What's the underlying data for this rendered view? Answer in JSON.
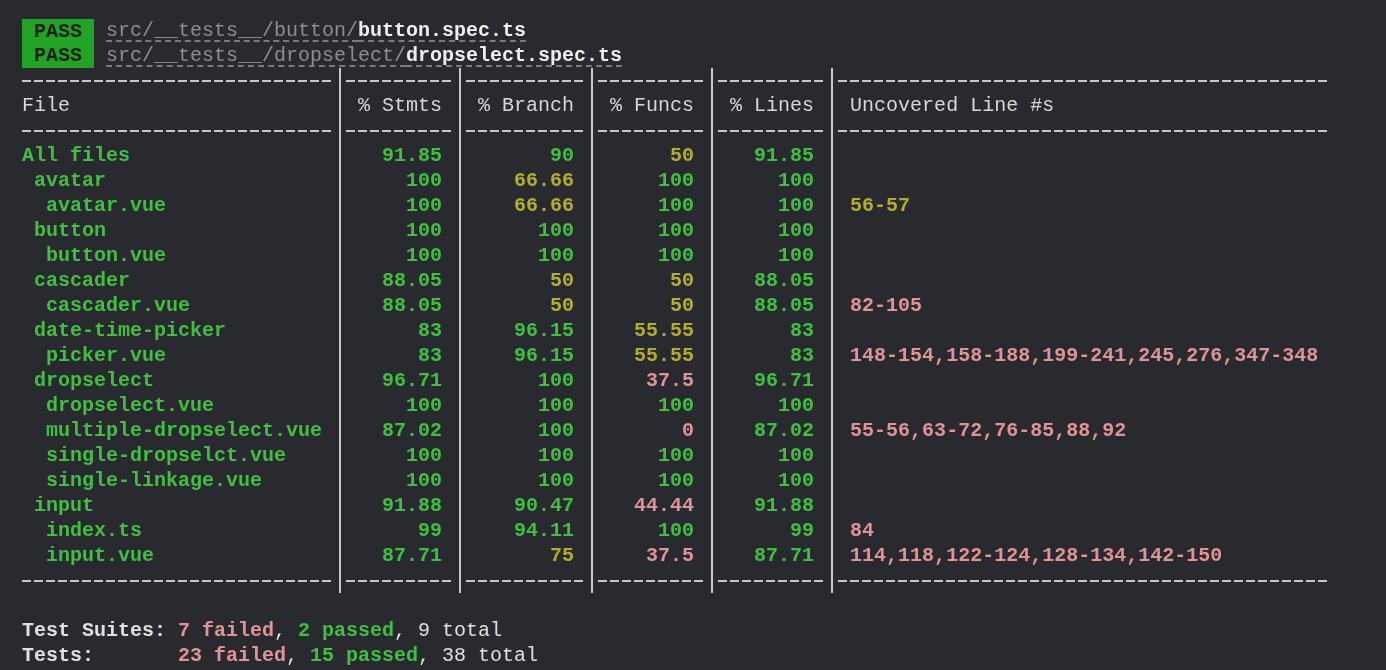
{
  "results": [
    {
      "status": "PASS",
      "path": "src/__tests__/button/**button.spec.ts**"
    },
    {
      "status": "PASS",
      "path": "src/__tests__/dropselect/**dropselect.spec.ts**"
    }
  ],
  "coverage": {
    "columns": [
      "File",
      "% Stmts",
      "% Branch",
      "% Funcs",
      "% Lines",
      "Uncovered Line #s"
    ],
    "rows": [
      {
        "cells": [
          {
            "value": "All files",
            "color": "#3ec23e"
          },
          {
            "value": "91.85",
            "color": "#3ec23e"
          },
          {
            "value": "90",
            "color": "#3ec23e"
          },
          {
            "value": "50",
            "color": "#b3ad2a"
          },
          {
            "value": "91.85",
            "color": "#3ec23e"
          }
        ],
        "children": [
          {
            "cells": [
              {
                "value": "avatar",
                "color": "#3ec23e"
              },
              {
                "value": "100",
                "color": "#3ec23e"
              },
              {
                "value": "66.66",
                "color": "#b3ad2a"
              },
              {
                "value": "100",
                "color": "#3ec23e"
              },
              {
                "value": "100",
                "color": "#3ec23e"
              }
            ],
            "children": [
              {
                "cells": [
                  {
                    "value": "avatar.vue",
                    "color": "#3ec23e"
                  },
                  {
                    "value": "100",
                    "color": "#3ec23e"
                  },
                  {
                    "value": "66.66",
                    "color": "#b3ad2a"
                  },
                  {
                    "value": "100",
                    "color": "#3ec23e"
                  },
                  {
                    "value": "100",
                    "color": "#3ec23e"
                  },
                  {
                    "value": "56-57",
                    "color": "#b3ad2a"
                  }
                ]
              }
            ]
          },
          {
            "cells": [
              {
                "value": "button",
                "color": "#3ec23e"
              },
              {
                "value": "100",
                "color": "#3ec23e"
              },
              {
                "value": "100",
                "color": "#3ec23e"
              },
              {
                "value": "100",
                "color": "#3ec23e"
              },
              {
                "value": "100",
                "color": "#3ec23e"
              }
            ],
            "children": [
              {
                "cells": [
                  {
                    "value": "button.vue",
                    "color": "#3ec23e"
                  },
                  {
                    "value": "100",
                    "color": "#3ec23e"
                  },
                  {
                    "value": "100",
                    "color": "#3ec23e"
                  },
                  {
                    "value": "100",
                    "color": "#3ec23e"
                  },
                  {
                    "value": "100",
                    "color": "#3ec23e"
                  }
                ]
              }
            ]
          },
          {
            "cells": [
              {
                "value": "cascader",
                "color": "#3ec23e"
              },
              {
                "value": "88.05",
                "color": "#3ec23e"
              },
              {
                "value": "50",
                "color": "#b3ad2a"
              },
              {
                "value": "50",
                "color": "#b3ad2a"
              },
              {
                "value": "88.05",
                "color": "#3ec23e"
              }
            ],
            "children": [
              {
                "cells": [
                  {
                    "value": "cascader.vue",
                    "color": "#3ec23e"
                  },
                  {
                    "value": "88.05",
                    "color": "#3ec23e"
                  },
                  {
                    "value": "50",
                    "color": "#b3ad2a"
                  },
                  {
                    "value": "50",
                    "color": "#b3ad2a"
                  },
                  {
                    "value": "88.05",
                    "color": "#3ec23e"
                  },
                  {
                    "value": "82-105",
                    "color": "#e29393"
                  }
                ]
              }
            ]
          },
          {
            "cells": [
              {
                "value": "date-time-picker",
                "color": "#3ec23e"
              },
              {
                "value": "83",
                "color": "#3ec23e"
              },
              {
                "value": "96.15",
                "color": "#3ec23e"
              },
              {
                "value": "55.55",
                "color": "#b3ad2a"
              },
              {
                "value": "83",
                "color": "#3ec23e"
              }
            ],
            "children": [
              {
                "cells": [
                  {
                    "value": "picker.vue",
                    "color": "#3ec23e"
                  },
                  {
                    "value": "83",
                    "color": "#3ec23e"
                  },
                  {
                    "value": "96.15",
                    "color": "#3ec23e"
                  },
                  {
                    "value": "55.55",
                    "color": "#b3ad2a"
                  },
                  {
                    "value": "83",
                    "color": "#3ec23e"
                  },
                  {
                    "value": "148-154,158-188,199-241,245,276,347-348",
                    "color": "#e29393"
                  }
                ]
              }
            ]
          },
          {
            "cells": [
              {
                "value": "dropselect",
                "color": "#3ec23e"
              },
              {
                "value": "96.71",
                "color": "#3ec23e"
              },
              {
                "value": "100",
                "color": "#3ec23e"
              },
              {
                "value": "37.5",
                "color": "#e29393"
              },
              {
                "value": "96.71",
                "color": "#3ec23e"
              }
            ],
            "children": [
              {
                "cells": [
                  {
                    "value": "dropselect.vue",
                    "color": "#3ec23e"
                  },
                  {
                    "value": "100",
                    "color": "#3ec23e"
                  },
                  {
                    "value": "100",
                    "color": "#3ec23e"
                  },
                  {
                    "value": "100",
                    "color": "#3ec23e"
                  },
                  {
                    "value": "100",
                    "color": "#3ec23e"
                  }
                ]
              },
              {
                "cells": [
                  {
                    "value": "multiple-dropselect.vue",
                    "color": "#3ec23e"
                  },
                  {
                    "value": "87.02",
                    "color": "#3ec23e"
                  },
                  {
                    "value": "100",
                    "color": "#3ec23e"
                  },
                  {
                    "value": "0",
                    "color": "#e29393"
                  },
                  {
                    "value": "87.02",
                    "color": "#3ec23e"
                  },
                  {
                    "value": "55-56,63-72,76-85,88,92",
                    "color": "#e29393"
                  }
                ]
              },
              {
                "cells": [
                  {
                    "value": "single-dropselct.vue",
                    "color": "#3ec23e"
                  },
                  {
                    "value": "100",
                    "color": "#3ec23e"
                  },
                  {
                    "value": "100",
                    "color": "#3ec23e"
                  },
                  {
                    "value": "100",
                    "color": "#3ec23e"
                  },
                  {
                    "value": "100",
                    "color": "#3ec23e"
                  }
                ]
              },
              {
                "cells": [
                  {
                    "value": "single-linkage.vue",
                    "color": "#3ec23e"
                  },
                  {
                    "value": "100",
                    "color": "#3ec23e"
                  },
                  {
                    "value": "100",
                    "color": "#3ec23e"
                  },
                  {
                    "value": "100",
                    "color": "#3ec23e"
                  },
                  {
                    "value": "100",
                    "color": "#3ec23e"
                  }
                ]
              }
            ]
          },
          {
            "cells": [
              {
                "value": "input",
                "color": "#3ec23e"
              },
              {
                "value": "91.88",
                "color": "#3ec23e"
              },
              {
                "value": "90.47",
                "color": "#3ec23e"
              },
              {
                "value": "44.44",
                "color": "#e29393"
              },
              {
                "value": "91.88",
                "color": "#3ec23e"
              }
            ],
            "children": [
              {
                "cells": [
                  {
                    "value": "index.ts",
                    "color": "#3ec23e"
                  },
                  {
                    "value": "99",
                    "color": "#3ec23e"
                  },
                  {
                    "value": "94.11",
                    "color": "#3ec23e"
                  },
                  {
                    "value": "100",
                    "color": "#3ec23e"
                  },
                  {
                    "value": "99",
                    "color": "#3ec23e"
                  },
                  {
                    "value": "84",
                    "color": "#e29393"
                  }
                ]
              },
              {
                "cells": [
                  {
                    "value": "input.vue",
                    "color": "#3ec23e"
                  },
                  {
                    "value": "87.71",
                    "color": "#3ec23e"
                  },
                  {
                    "value": "75",
                    "color": "#b3ad2a"
                  },
                  {
                    "value": "37.5",
                    "color": "#e29393"
                  },
                  {
                    "value": "87.71",
                    "color": "#3ec23e"
                  },
                  {
                    "value": "114,118,122-124,128-134,142-150",
                    "color": "#e29393"
                  }
                ]
              }
            ]
          }
        ]
      }
    ]
  },
  "summary": [
    {
      "label": "Test Suites:",
      "parts": [
        {
          "text": "7 failed",
          "kind": "failed"
        },
        {
          "text": ", ",
          "kind": "plain"
        },
        {
          "text": "2 passed",
          "kind": "passed"
        },
        {
          "text": ", ",
          "kind": "plain"
        },
        {
          "text": "9 total",
          "kind": "plain"
        }
      ]
    },
    {
      "label": "Tests:",
      "parts": [
        {
          "text": "23 failed",
          "kind": "failed"
        },
        {
          "text": ", ",
          "kind": "plain"
        },
        {
          "text": "15 passed",
          "kind": "passed"
        },
        {
          "text": ", ",
          "kind": "plain"
        },
        {
          "text": "38 total",
          "kind": "plain"
        }
      ]
    }
  ]
}
